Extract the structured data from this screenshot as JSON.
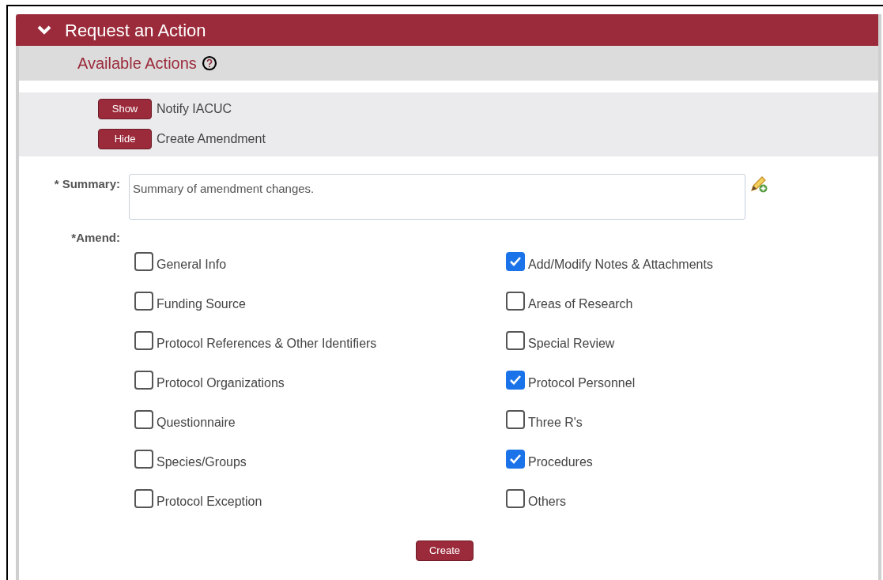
{
  "header": {
    "title": "Request an Action",
    "expanded": true
  },
  "subheader": {
    "title": "Available Actions"
  },
  "actions": [
    {
      "button": "Show",
      "label": "Notify IACUC"
    },
    {
      "button": "Hide",
      "label": "Create Amendment"
    }
  ],
  "summary": {
    "label": "* Summary:",
    "value": "Summary of amendment changes."
  },
  "amend": {
    "label": "*Amend:",
    "options": [
      {
        "label": "General Info",
        "checked": false
      },
      {
        "label": "Add/Modify Notes & Attachments",
        "checked": true
      },
      {
        "label": "Funding Source",
        "checked": false
      },
      {
        "label": "Areas of Research",
        "checked": false
      },
      {
        "label": "Protocol References & Other Identifiers",
        "checked": false
      },
      {
        "label": "Special Review",
        "checked": false
      },
      {
        "label": "Protocol Organizations",
        "checked": false
      },
      {
        "label": "Protocol Personnel",
        "checked": true
      },
      {
        "label": "Questionnaire",
        "checked": false
      },
      {
        "label": "Three R's",
        "checked": false
      },
      {
        "label": "Species/Groups",
        "checked": false
      },
      {
        "label": "Procedures",
        "checked": true
      },
      {
        "label": "Protocol Exception",
        "checked": false
      },
      {
        "label": "Others",
        "checked": false
      }
    ]
  },
  "create_button": "Create"
}
